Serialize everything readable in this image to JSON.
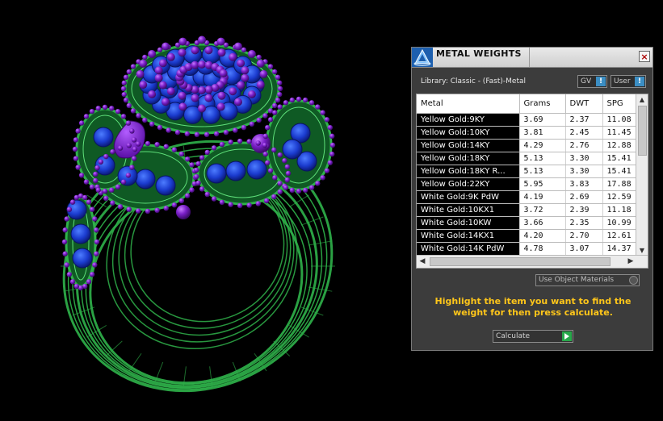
{
  "panel": {
    "title": "METAL WEIGHTS",
    "close_glyph": "×",
    "library": "Library: Classic - (Fast)-Metal",
    "gv_label": "GV",
    "user_label": "User",
    "info_glyph": "!",
    "use_object_materials": "Use Object Materials",
    "instruction": "Highlight the item you want to find the weight for then press calculate.",
    "calculate_label": "Calculate"
  },
  "table": {
    "headers": [
      "Metal",
      "Grams",
      "DWT",
      "SPG"
    ],
    "rows": [
      [
        "Yellow Gold:9KY",
        "3.69",
        "2.37",
        "11.08"
      ],
      [
        "Yellow Gold:10KY",
        "3.81",
        "2.45",
        "11.45"
      ],
      [
        "Yellow Gold:14KY",
        "4.29",
        "2.76",
        "12.88"
      ],
      [
        "Yellow Gold:18KY",
        "5.13",
        "3.30",
        "15.41"
      ],
      [
        "Yellow Gold:18KY R...",
        "5.13",
        "3.30",
        "15.41"
      ],
      [
        "Yellow Gold:22KY",
        "5.95",
        "3.83",
        "17.88"
      ],
      [
        "White Gold:9K PdW",
        "4.19",
        "2.69",
        "12.59"
      ],
      [
        "White Gold:10KX1",
        "3.72",
        "2.39",
        "11.18"
      ],
      [
        "White Gold:10KW",
        "3.66",
        "2.35",
        "10.99"
      ],
      [
        "White Gold:14KX1",
        "4.20",
        "2.70",
        "12.61"
      ],
      [
        "White Gold:14K PdW",
        "4.78",
        "3.07",
        "14.37"
      ]
    ]
  },
  "colors": {
    "metal_green": "#2fb24a",
    "gem_blue": "#1d3fd6",
    "bead_purple": "#7a1fc8",
    "instruction_text": "#ffc61a"
  }
}
